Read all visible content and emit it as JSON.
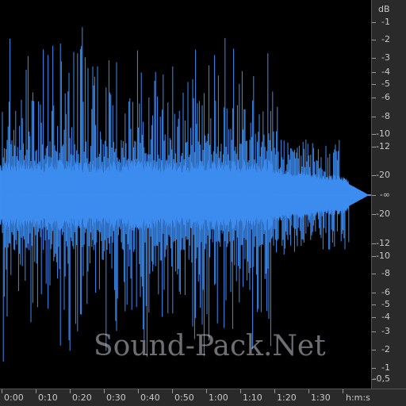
{
  "colors": {
    "waveform": "#3d8cf0",
    "background": "#000000",
    "ruler_bg": "#2a2a2a",
    "ruler_text": "#c8c8c8"
  },
  "db_ruler": {
    "unit": "dB",
    "labels_top": [
      "-1",
      "-2",
      "-3",
      "-4",
      "-5",
      "-6",
      "-8",
      "-10",
      "-12",
      "-20",
      "-∞"
    ],
    "labels_bottom": [
      "-20",
      "-12",
      "-10",
      "-8",
      "-6",
      "-5",
      "-4",
      "-3",
      "-2",
      "-1",
      "-0,5"
    ]
  },
  "time_ruler": {
    "labels": [
      "0:00",
      "0:10",
      "0:20",
      "0:30",
      "0:40",
      "0:50",
      "1:00",
      "1:10",
      "1:20",
      "1:30"
    ],
    "unit": "h:m:s"
  },
  "watermark": {
    "text": "Sound-Pack.Net"
  }
}
